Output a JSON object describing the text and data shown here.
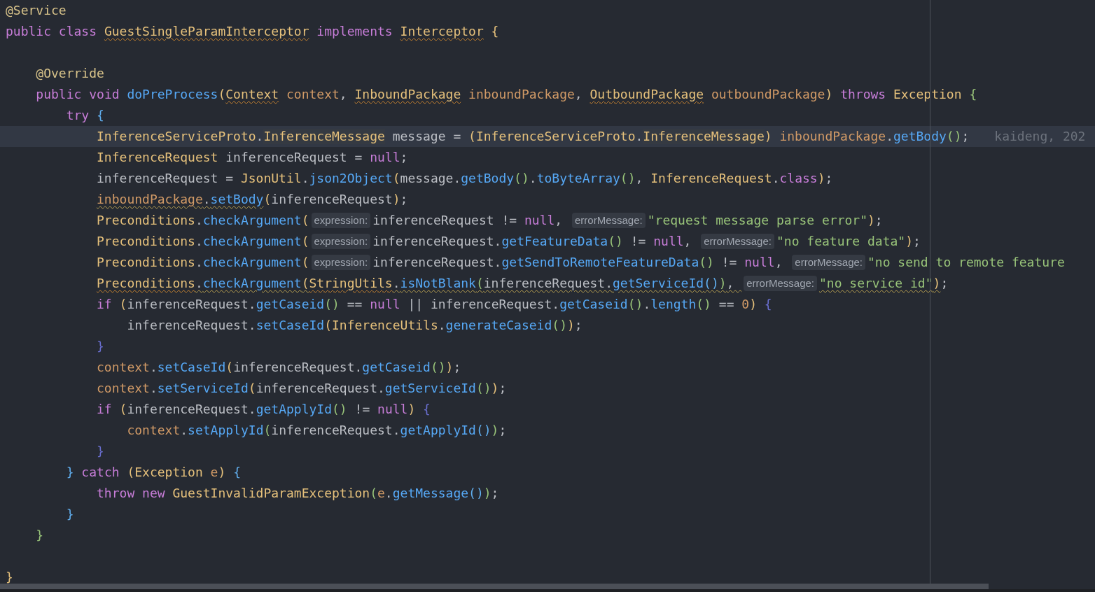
{
  "editor": {
    "lines": [
      {
        "current": false,
        "tokens": [
          {
            "text": "@Service",
            "kind": "ann"
          }
        ]
      },
      {
        "current": false,
        "tokens": [
          {
            "text": "public class ",
            "kind": "kw"
          },
          {
            "text": "GuestSingleParamInterceptor",
            "kind": "type",
            "squiggle": true
          },
          {
            "text": " implements ",
            "kind": "kw"
          },
          {
            "text": "Interceptor",
            "kind": "type",
            "squiggle": true
          },
          {
            "text": " {",
            "kind": "bracket",
            "color": "#e5c07b"
          }
        ],
        "children": [
          {
            "current": false
          },
          {
            "current": false,
            "tokens": [
              {
                "text": "@Override",
                "kind": "ann"
              }
            ]
          },
          {
            "current": false,
            "tokens": [
              {
                "text": "public void ",
                "kind": "kw"
              },
              {
                "text": "doPreProcess",
                "kind": "fn"
              },
              {
                "text": "(",
                "kind": "bracket",
                "color": "#e5c07b"
              },
              {
                "text": "Context",
                "kind": "type",
                "squiggle": true
              },
              {
                "text": " context",
                "kind": "param"
              },
              {
                "text": ", ",
                "kind": "plain"
              },
              {
                "text": "InboundPackage",
                "kind": "type",
                "squiggle": true
              },
              {
                "text": " inboundPackage",
                "kind": "param"
              },
              {
                "text": ", ",
                "kind": "plain"
              },
              {
                "text": "OutboundPackage",
                "kind": "type",
                "squiggle": true
              },
              {
                "text": " outboundPackage",
                "kind": "param"
              },
              {
                "text": ")",
                "kind": "bracket",
                "color": "#e5c07b"
              },
              {
                "text": " throws ",
                "kind": "kw"
              },
              {
                "text": "Exception",
                "kind": "type"
              },
              {
                "text": " {",
                "kind": "bracket",
                "color": "#98c379"
              }
            ],
            "children": [
              {
                "current": false,
                "tokens": [
                  {
                    "text": "try",
                    "kind": "kw"
                  },
                  {
                    "text": " {",
                    "kind": "bracket",
                    "color": "#61afef"
                  }
                ],
                "children": [
                  {
                    "current": true,
                    "tokens": [
                      {
                        "text": "InferenceServiceProto",
                        "kind": "type"
                      },
                      {
                        "text": ".",
                        "kind": "plain"
                      },
                      {
                        "text": "InferenceMessage",
                        "kind": "type",
                        "highlighted": true
                      },
                      {
                        "text": " message = ",
                        "kind": "plain"
                      },
                      {
                        "text": "(",
                        "kind": "bracket",
                        "color": "#e5c07b"
                      },
                      {
                        "text": "InferenceServiceProto",
                        "kind": "type"
                      },
                      {
                        "text": ".",
                        "kind": "plain"
                      },
                      {
                        "text": "InferenceMessage",
                        "kind": "type",
                        "highlighted": true
                      },
                      {
                        "text": ")",
                        "kind": "bracket",
                        "color": "#e5c07b"
                      },
                      {
                        "text": " inboundPackage",
                        "kind": "param"
                      },
                      {
                        "text": ".",
                        "kind": "plain"
                      },
                      {
                        "text": "getBody",
                        "kind": "fn"
                      },
                      {
                        "text": "()",
                        "kind": "bracket",
                        "color": "#98c379"
                      },
                      {
                        "text": ";",
                        "kind": "plain"
                      },
                      {
                        "text": "kaideng, 202",
                        "kind": "blame"
                      }
                    ]
                  },
                  {
                    "current": false,
                    "tokens": [
                      {
                        "text": "InferenceRequest",
                        "kind": "type"
                      },
                      {
                        "text": " inferenceRequest = ",
                        "kind": "plain"
                      },
                      {
                        "text": "null",
                        "kind": "kw"
                      },
                      {
                        "text": ";",
                        "kind": "plain"
                      }
                    ]
                  },
                  {
                    "current": false,
                    "tokens": [
                      {
                        "text": "inferenceRequest = ",
                        "kind": "plain"
                      },
                      {
                        "text": "JsonUtil",
                        "kind": "type"
                      },
                      {
                        "text": ".",
                        "kind": "plain"
                      },
                      {
                        "text": "json2Object",
                        "kind": "fn"
                      },
                      {
                        "text": "(",
                        "kind": "bracket",
                        "color": "#e5c07b"
                      },
                      {
                        "text": "message.",
                        "kind": "plain"
                      },
                      {
                        "text": "getBody",
                        "kind": "fn"
                      },
                      {
                        "text": "()",
                        "kind": "bracket",
                        "color": "#98c379"
                      },
                      {
                        "text": ".",
                        "kind": "plain"
                      },
                      {
                        "text": "toByteArray",
                        "kind": "fn"
                      },
                      {
                        "text": "()",
                        "kind": "bracket",
                        "color": "#98c379"
                      },
                      {
                        "text": ", ",
                        "kind": "plain"
                      },
                      {
                        "text": "InferenceRequest",
                        "kind": "type"
                      },
                      {
                        "text": ".",
                        "kind": "plain"
                      },
                      {
                        "text": "class",
                        "kind": "kw"
                      },
                      {
                        "text": ")",
                        "kind": "bracket",
                        "color": "#e5c07b"
                      },
                      {
                        "text": ";",
                        "kind": "plain"
                      }
                    ]
                  },
                  {
                    "current": false,
                    "tokens": [
                      {
                        "text": "inboundPackage",
                        "kind": "param",
                        "squiggle": true
                      },
                      {
                        "text": ".",
                        "kind": "plain",
                        "squiggle": true
                      },
                      {
                        "text": "setBody",
                        "kind": "fn",
                        "squiggle": true
                      },
                      {
                        "text": "(",
                        "kind": "bracket",
                        "color": "#e5c07b"
                      },
                      {
                        "text": "inferenceRequest",
                        "kind": "plain"
                      },
                      {
                        "text": ")",
                        "kind": "bracket",
                        "color": "#e5c07b"
                      },
                      {
                        "text": ";",
                        "kind": "plain"
                      }
                    ]
                  },
                  {
                    "current": false,
                    "tokens": [
                      {
                        "text": "Preconditions",
                        "kind": "type"
                      },
                      {
                        "text": ".",
                        "kind": "plain"
                      },
                      {
                        "text": "checkArgument",
                        "kind": "fn"
                      },
                      {
                        "text": "(",
                        "kind": "bracket",
                        "color": "#e5c07b"
                      },
                      {
                        "text": "expression:",
                        "kind": "hint"
                      },
                      {
                        "text": "inferenceRequest != ",
                        "kind": "plain"
                      },
                      {
                        "text": "null",
                        "kind": "kw"
                      },
                      {
                        "text": ", ",
                        "kind": "plain"
                      },
                      {
                        "text": "errorMessage:",
                        "kind": "hint"
                      },
                      {
                        "text": "\"request message parse error\"",
                        "kind": "str"
                      },
                      {
                        "text": ")",
                        "kind": "bracket",
                        "color": "#e5c07b"
                      },
                      {
                        "text": ";",
                        "kind": "plain"
                      }
                    ]
                  },
                  {
                    "current": false,
                    "tokens": [
                      {
                        "text": "Preconditions",
                        "kind": "type"
                      },
                      {
                        "text": ".",
                        "kind": "plain"
                      },
                      {
                        "text": "checkArgument",
                        "kind": "fn"
                      },
                      {
                        "text": "(",
                        "kind": "bracket",
                        "color": "#e5c07b"
                      },
                      {
                        "text": "expression:",
                        "kind": "hint"
                      },
                      {
                        "text": "inferenceRequest.",
                        "kind": "plain"
                      },
                      {
                        "text": "getFeatureData",
                        "kind": "fn"
                      },
                      {
                        "text": "()",
                        "kind": "bracket",
                        "color": "#98c379"
                      },
                      {
                        "text": " != ",
                        "kind": "plain"
                      },
                      {
                        "text": "null",
                        "kind": "kw"
                      },
                      {
                        "text": ", ",
                        "kind": "plain"
                      },
                      {
                        "text": "errorMessage:",
                        "kind": "hint"
                      },
                      {
                        "text": "\"no feature data\"",
                        "kind": "str"
                      },
                      {
                        "text": ")",
                        "kind": "bracket",
                        "color": "#e5c07b"
                      },
                      {
                        "text": ";",
                        "kind": "plain"
                      }
                    ]
                  },
                  {
                    "current": false,
                    "tokens": [
                      {
                        "text": "Preconditions",
                        "kind": "type"
                      },
                      {
                        "text": ".",
                        "kind": "plain"
                      },
                      {
                        "text": "checkArgument",
                        "kind": "fn"
                      },
                      {
                        "text": "(",
                        "kind": "bracket",
                        "color": "#e5c07b"
                      },
                      {
                        "text": "expression:",
                        "kind": "hint"
                      },
                      {
                        "text": "inferenceRequest.",
                        "kind": "plain"
                      },
                      {
                        "text": "getSendToRemoteFeatureData",
                        "kind": "fn"
                      },
                      {
                        "text": "()",
                        "kind": "bracket",
                        "color": "#98c379"
                      },
                      {
                        "text": " != ",
                        "kind": "plain"
                      },
                      {
                        "text": "null",
                        "kind": "kw"
                      },
                      {
                        "text": ", ",
                        "kind": "plain"
                      },
                      {
                        "text": "errorMessage:",
                        "kind": "hint"
                      },
                      {
                        "text": "\"no send to remote feature",
                        "kind": "str"
                      }
                    ]
                  },
                  {
                    "current": false,
                    "tokens": [
                      {
                        "text": "Preconditions",
                        "kind": "type",
                        "squiggle": true
                      },
                      {
                        "text": ".",
                        "kind": "plain",
                        "squiggle": true
                      },
                      {
                        "text": "checkArgument",
                        "kind": "fn",
                        "squiggle": true
                      },
                      {
                        "text": "(",
                        "kind": "bracket",
                        "color": "#e5c07b",
                        "squiggle": true
                      },
                      {
                        "text": "StringUtils",
                        "kind": "type",
                        "squiggle": true
                      },
                      {
                        "text": ".",
                        "kind": "plain",
                        "squiggle": true
                      },
                      {
                        "text": "isNotBlank",
                        "kind": "fn",
                        "squiggle": true
                      },
                      {
                        "text": "(",
                        "kind": "bracket",
                        "color": "#98c379",
                        "squiggle": true
                      },
                      {
                        "text": "inferenceRequest.",
                        "kind": "plain",
                        "squiggle": true
                      },
                      {
                        "text": "getServiceId",
                        "kind": "fn",
                        "squiggle": true
                      },
                      {
                        "text": "()",
                        "kind": "bracket",
                        "color": "#61afef",
                        "squiggle": true
                      },
                      {
                        "text": ")",
                        "kind": "bracket",
                        "color": "#98c379",
                        "squiggle": true
                      },
                      {
                        "text": ", ",
                        "kind": "plain",
                        "squiggle": true
                      },
                      {
                        "text": "errorMessage:",
                        "kind": "hint"
                      },
                      {
                        "text": "\"no service id\"",
                        "kind": "str",
                        "squiggle": true
                      },
                      {
                        "text": ")",
                        "kind": "bracket",
                        "color": "#e5c07b",
                        "squiggle": true
                      },
                      {
                        "text": ";",
                        "kind": "plain"
                      }
                    ]
                  },
                  {
                    "current": false,
                    "tokens": [
                      {
                        "text": "if",
                        "kind": "kw"
                      },
                      {
                        "text": " (",
                        "kind": "bracket",
                        "color": "#e5c07b"
                      },
                      {
                        "text": "inferenceRequest.",
                        "kind": "plain"
                      },
                      {
                        "text": "getCaseid",
                        "kind": "fn"
                      },
                      {
                        "text": "()",
                        "kind": "bracket",
                        "color": "#98c379"
                      },
                      {
                        "text": " == ",
                        "kind": "plain"
                      },
                      {
                        "text": "null",
                        "kind": "kw"
                      },
                      {
                        "text": " || inferenceRequest.",
                        "kind": "plain"
                      },
                      {
                        "text": "getCaseid",
                        "kind": "fn"
                      },
                      {
                        "text": "()",
                        "kind": "bracket",
                        "color": "#98c379"
                      },
                      {
                        "text": ".",
                        "kind": "plain"
                      },
                      {
                        "text": "length",
                        "kind": "fn"
                      },
                      {
                        "text": "()",
                        "kind": "bracket",
                        "color": "#98c379"
                      },
                      {
                        "text": " == ",
                        "kind": "plain"
                      },
                      {
                        "text": "0",
                        "kind": "num"
                      },
                      {
                        "text": ")",
                        "kind": "bracket",
                        "color": "#e5c07b"
                      },
                      {
                        "text": " {",
                        "kind": "bracket",
                        "color": "#6a6fd0"
                      }
                    ],
                    "children": [
                      {
                        "current": false,
                        "tokens": [
                          {
                            "text": "inferenceRequest.",
                            "kind": "plain"
                          },
                          {
                            "text": "setCaseId",
                            "kind": "fn"
                          },
                          {
                            "text": "(",
                            "kind": "bracket",
                            "color": "#e5c07b"
                          },
                          {
                            "text": "InferenceUtils",
                            "kind": "type"
                          },
                          {
                            "text": ".",
                            "kind": "plain"
                          },
                          {
                            "text": "generateCaseid",
                            "kind": "fn"
                          },
                          {
                            "text": "()",
                            "kind": "bracket",
                            "color": "#98c379"
                          },
                          {
                            "text": ")",
                            "kind": "bracket",
                            "color": "#e5c07b"
                          },
                          {
                            "text": ";",
                            "kind": "plain"
                          }
                        ]
                      }
                    ]
                  },
                  {
                    "current": false,
                    "tokens": [
                      {
                        "text": "}",
                        "kind": "bracket",
                        "color": "#6a6fd0"
                      }
                    ]
                  },
                  {
                    "current": false,
                    "tokens": [
                      {
                        "text": "context",
                        "kind": "param"
                      },
                      {
                        "text": ".",
                        "kind": "plain"
                      },
                      {
                        "text": "setCaseId",
                        "kind": "fn"
                      },
                      {
                        "text": "(",
                        "kind": "bracket",
                        "color": "#e5c07b"
                      },
                      {
                        "text": "inferenceRequest.",
                        "kind": "plain"
                      },
                      {
                        "text": "getCaseid",
                        "kind": "fn"
                      },
                      {
                        "text": "()",
                        "kind": "bracket",
                        "color": "#98c379"
                      },
                      {
                        "text": ")",
                        "kind": "bracket",
                        "color": "#e5c07b"
                      },
                      {
                        "text": ";",
                        "kind": "plain"
                      }
                    ]
                  },
                  {
                    "current": false,
                    "tokens": [
                      {
                        "text": "context",
                        "kind": "param"
                      },
                      {
                        "text": ".",
                        "kind": "plain"
                      },
                      {
                        "text": "setServiceId",
                        "kind": "fn"
                      },
                      {
                        "text": "(",
                        "kind": "bracket",
                        "color": "#e5c07b"
                      },
                      {
                        "text": "inferenceRequest.",
                        "kind": "plain"
                      },
                      {
                        "text": "getServiceId",
                        "kind": "fn"
                      },
                      {
                        "text": "()",
                        "kind": "bracket",
                        "color": "#98c379"
                      },
                      {
                        "text": ")",
                        "kind": "bracket",
                        "color": "#e5c07b"
                      },
                      {
                        "text": ";",
                        "kind": "plain"
                      }
                    ]
                  },
                  {
                    "current": false,
                    "tokens": [
                      {
                        "text": "if",
                        "kind": "kw"
                      },
                      {
                        "text": " (",
                        "kind": "bracket",
                        "color": "#e5c07b"
                      },
                      {
                        "text": "inferenceRequest.",
                        "kind": "plain"
                      },
                      {
                        "text": "getApplyId",
                        "kind": "fn"
                      },
                      {
                        "text": "()",
                        "kind": "bracket",
                        "color": "#98c379"
                      },
                      {
                        "text": " != ",
                        "kind": "plain"
                      },
                      {
                        "text": "null",
                        "kind": "kw"
                      },
                      {
                        "text": ")",
                        "kind": "bracket",
                        "color": "#e5c07b"
                      },
                      {
                        "text": " {",
                        "kind": "bracket",
                        "color": "#6a6fd0"
                      }
                    ],
                    "children": [
                      {
                        "current": false,
                        "tokens": [
                          {
                            "text": "context",
                            "kind": "param"
                          },
                          {
                            "text": ".",
                            "kind": "plain"
                          },
                          {
                            "text": "setApplyId",
                            "kind": "fn"
                          },
                          {
                            "text": "(",
                            "kind": "bracket",
                            "color": "#98c379"
                          },
                          {
                            "text": "inferenceRequest.",
                            "kind": "plain"
                          },
                          {
                            "text": "getApplyId",
                            "kind": "fn"
                          },
                          {
                            "text": "()",
                            "kind": "bracket",
                            "color": "#61afef"
                          },
                          {
                            "text": ")",
                            "kind": "bracket",
                            "color": "#98c379"
                          },
                          {
                            "text": ";",
                            "kind": "plain"
                          }
                        ]
                      }
                    ]
                  },
                  {
                    "current": false,
                    "tokens": [
                      {
                        "text": "}",
                        "kind": "bracket",
                        "color": "#6a6fd0"
                      }
                    ]
                  }
                ]
              },
              {
                "current": false,
                "tokens": [
                  {
                    "text": "}",
                    "kind": "bracket",
                    "color": "#61afef"
                  },
                  {
                    "text": " catch ",
                    "kind": "kw"
                  },
                  {
                    "text": "(",
                    "kind": "bracket",
                    "color": "#e5c07b"
                  },
                  {
                    "text": "Exception",
                    "kind": "type"
                  },
                  {
                    "text": " e",
                    "kind": "param"
                  },
                  {
                    "text": ")",
                    "kind": "bracket",
                    "color": "#e5c07b"
                  },
                  {
                    "text": " {",
                    "kind": "bracket",
                    "color": "#61afef"
                  }
                ],
                "children": [
                  {
                    "current": false,
                    "tokens": [
                      {
                        "text": "throw new ",
                        "kind": "kw"
                      },
                      {
                        "text": "GuestInvalidParamException",
                        "kind": "type"
                      },
                      {
                        "text": "(",
                        "kind": "bracket",
                        "color": "#98c379"
                      },
                      {
                        "text": "e",
                        "kind": "param"
                      },
                      {
                        "text": ".",
                        "kind": "plain"
                      },
                      {
                        "text": "getMessage",
                        "kind": "fn"
                      },
                      {
                        "text": "()",
                        "kind": "bracket",
                        "color": "#61afef"
                      },
                      {
                        "text": ")",
                        "kind": "bracket",
                        "color": "#98c379"
                      },
                      {
                        "text": ";",
                        "kind": "plain"
                      }
                    ]
                  }
                ]
              },
              {
                "current": false,
                "tokens": [
                  {
                    "text": "}",
                    "kind": "bracket",
                    "color": "#61afef"
                  }
                ]
              }
            ]
          },
          {
            "current": false,
            "tokens": [
              {
                "text": "}",
                "kind": "bracket",
                "color": "#98c379"
              }
            ]
          },
          {
            "current": false
          }
        ]
      },
      {
        "current": false,
        "tokens": [
          {
            "text": "}",
            "kind": "bracket",
            "color": "#e5c07b"
          }
        ]
      }
    ]
  }
}
